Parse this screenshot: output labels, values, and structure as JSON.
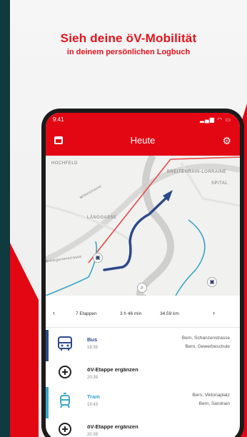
{
  "headline": {
    "line1": "Sieh deine öV-Mobilität",
    "line2": "in deinem persönlichen Logbuch"
  },
  "status_bar": {
    "time": "9:41",
    "icons": "signal-wifi-battery"
  },
  "app_bar": {
    "title": "Heute"
  },
  "map": {
    "labels": {
      "hochfeld": "HOCHFELD",
      "breitenrain": "BREITENRAIN-LORRAINE",
      "spital": "SPITAL",
      "laenggasse": "LÄNGGASSE",
      "street1": "Mittelstrasse",
      "street2": "Bremgartenstrasse"
    }
  },
  "summary": {
    "stages": "7 Etappen",
    "duration": "3 h 46 min",
    "distance": "34.59 km"
  },
  "colors": {
    "accent": "#e30613",
    "bus": "#2c4a8a",
    "tram": "#3aa6c9"
  },
  "stages": [
    {
      "type": "Bus",
      "time": "18:39",
      "from": "Bern, Schanzenstrasse",
      "to": "Bern, Gewerbeschule"
    },
    {
      "type": "öV-Etappe ergänzen",
      "time": "20:39"
    },
    {
      "type": "Tram",
      "time": "19:43",
      "from": "Bern, Viktoriaplatz",
      "to": "Bern, Sandrain"
    },
    {
      "type": "öV-Etappe ergänzen",
      "time": "20:39"
    }
  ]
}
